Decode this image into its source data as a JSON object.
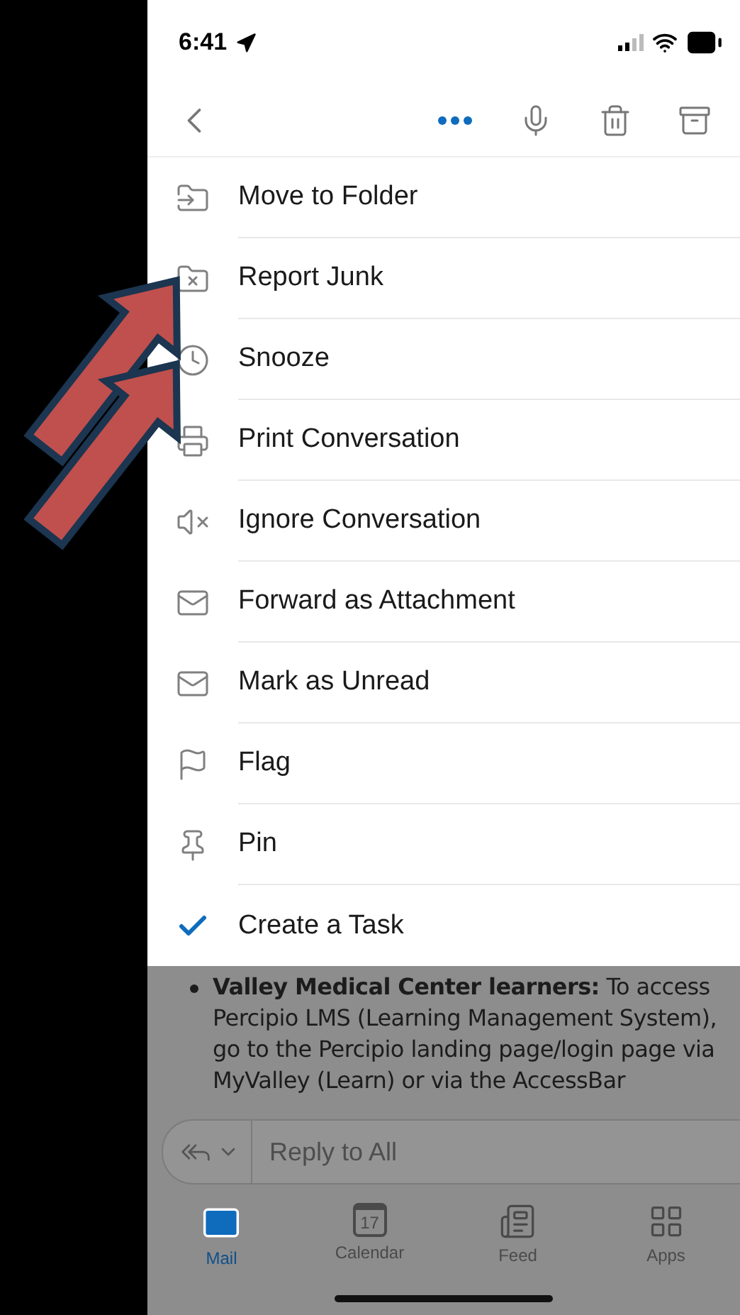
{
  "status_bar": {
    "time": "6:41"
  },
  "menu": {
    "items": [
      {
        "label": "Move to Folder"
      },
      {
        "label": "Report Junk"
      },
      {
        "label": "Snooze"
      },
      {
        "label": "Print Conversation"
      },
      {
        "label": "Ignore Conversation"
      },
      {
        "label": "Forward as Attachment"
      },
      {
        "label": "Mark as Unread"
      },
      {
        "label": "Flag"
      },
      {
        "label": "Pin"
      },
      {
        "label": "Create a Task"
      }
    ]
  },
  "message": {
    "bullet": "**Valley Medical Center learners:** To access Percipio LMS (Learning Management System), go to the Percipio landing page/login page via MyValley (Learn) or via the AccessBar"
  },
  "reply": {
    "placeholder": "Reply to All"
  },
  "tabs": [
    {
      "label": "Mail",
      "selected": true
    },
    {
      "label": "Calendar",
      "selected": false,
      "date": "17"
    },
    {
      "label": "Feed",
      "selected": false
    },
    {
      "label": "Apps",
      "selected": false
    }
  ]
}
